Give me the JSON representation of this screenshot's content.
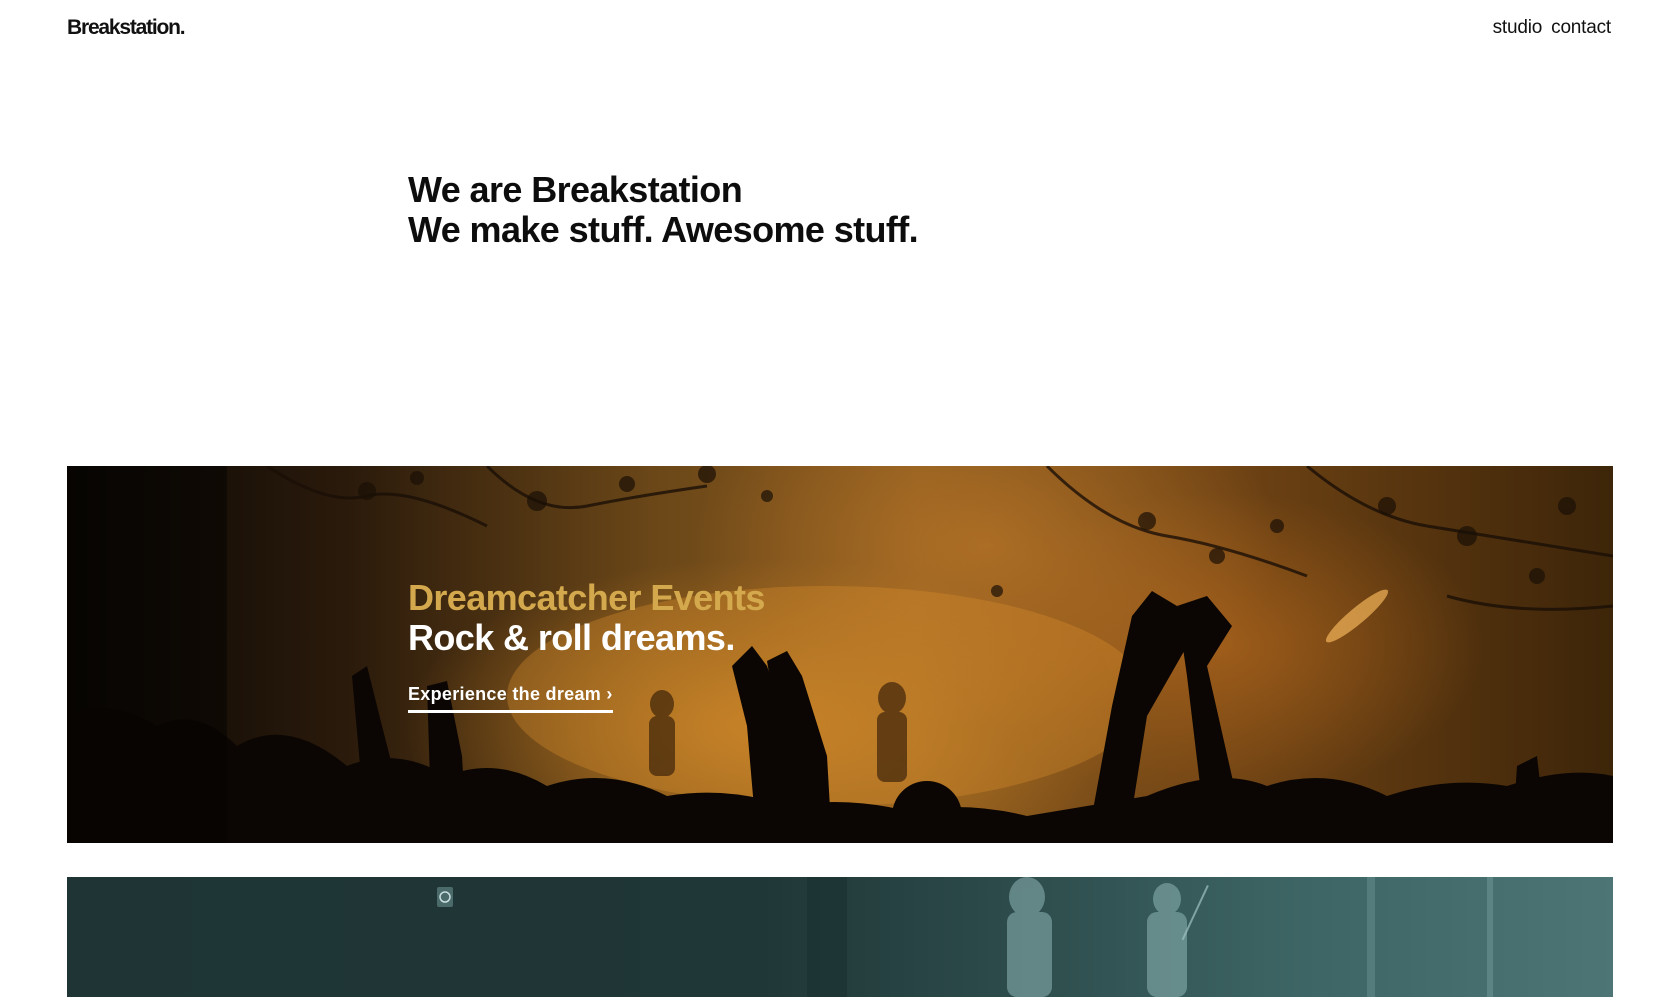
{
  "header": {
    "logo": "Breakstation.",
    "nav": [
      {
        "label": "studio"
      },
      {
        "label": "contact"
      }
    ]
  },
  "intro": {
    "line1": "We are Breakstation",
    "line2": "We make stuff. Awesome stuff."
  },
  "projects": [
    {
      "client": "Dreamcatcher Events",
      "tagline": "Rock & roll dreams.",
      "cta": "Experience the dream ›",
      "accent_color": "#d4a94e"
    },
    {
      "client": "",
      "tagline": ""
    }
  ]
}
